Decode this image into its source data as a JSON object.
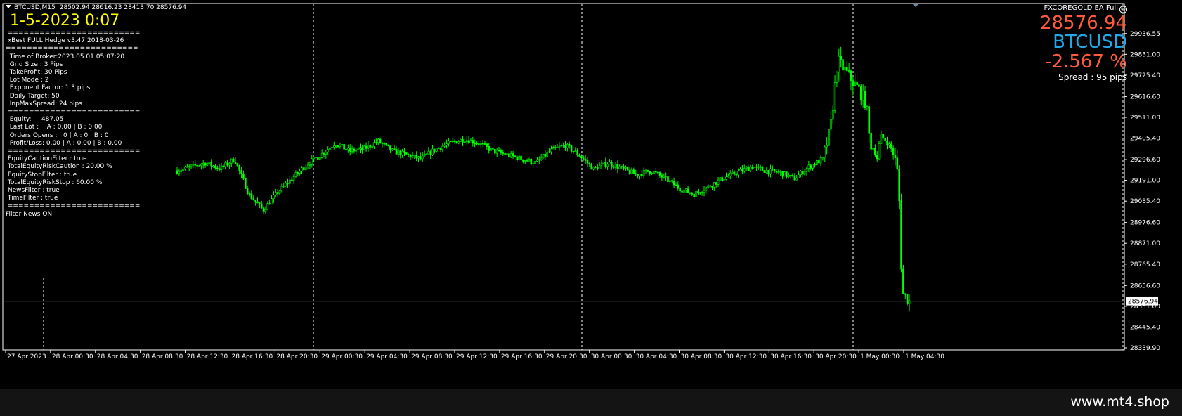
{
  "header": {
    "symbol_tf": "BTCUSD,M15",
    "ohlc": "28502.94 28616.23 28413.70 28576.94"
  },
  "datetime": "1-5-2023 0:07",
  "info_lines": [
    " =========================",
    " xBest FULL Hedge v3.47 2018-03-26",
    "=========================",
    "  Time of Broker:2023.05.01 05:07:20",
    "  Grid Size : 3 Pips",
    "  TakeProfit: 30 Pips",
    "  Lot Mode : 2",
    "  Exponent Factor: 1.3 pips",
    "  Daily Target: 50",
    "  InpMaxSpread: 24 pips",
    " =========================",
    "  Equity:     487.05",
    "  Last Lot :  | A : 0.00 | B : 0.00",
    "  Orders Opens :   0 | A : 0 | B : 0",
    "  Profit/Loss: 0.00 | A : 0.00 | B : 0.00",
    " =========================",
    " EquityCautionFilter : true",
    " TotalEquityRiskCaution : 20.00 %",
    " EquityStopFilter : true",
    " TotalEquityRiskStop : 60.00 %",
    " NewsFilter : true",
    " TimeFilter : true",
    " =========================",
    "Filter News ON"
  ],
  "right_panel": {
    "ea_name": "FXCOREGOLD EA Full",
    "ea_icon": "smiley-icon",
    "price": "28576.94",
    "symbol": "BTCUSD",
    "change": "-2.567 %",
    "spread": "Spread : 95 pips"
  },
  "footer": {
    "brand": "www.mt4.shop"
  },
  "colors": {
    "candle": "#00ff00",
    "price_big": "#ff5a3c",
    "symbol_big": "#1fa9e8",
    "datetime": "#ffff00"
  },
  "chart_data": {
    "type": "candlestick",
    "current_price": 28576.94,
    "current_price_label": "28576.94",
    "ylim": [
      28339.9,
      30000.0
    ],
    "y_ticks": [
      29936.55,
      29831.0,
      29725.4,
      29616.6,
      29511.0,
      29405.4,
      29296.6,
      29191.0,
      29085.4,
      28976.6,
      28871.0,
      28765.4,
      28656.6,
      28551.0,
      28445.4,
      28339.9
    ],
    "y_tick_labels": [
      "29936.55",
      "29831.00",
      "29725.40",
      "29616.60",
      "29511.00",
      "29405.40",
      "29296.60",
      "29191.00",
      "29085.40",
      "28976.60",
      "28871.00",
      "28765.40",
      "28656.60",
      "28551.00",
      "28445.40",
      "28339.90"
    ],
    "x_ticks": [
      "27 Apr 2023",
      "28 Apr 00:30",
      "28 Apr 04:30",
      "28 Apr 08:30",
      "28 Apr 12:30",
      "28 Apr 16:30",
      "28 Apr 20:30",
      "29 Apr 00:30",
      "29 Apr 04:30",
      "29 Apr 08:30",
      "29 Apr 12:30",
      "29 Apr 16:30",
      "29 Apr 20:30",
      "30 Apr 00:30",
      "30 Apr 04:30",
      "30 Apr 08:30",
      "30 Apr 12:30",
      "30 Apr 16:30",
      "30 Apr 20:30",
      "1 May 00:30",
      "1 May 04:30"
    ],
    "day_separators": [
      "28 Apr",
      "29 Apr",
      "30 Apr",
      "1 May"
    ],
    "price_path": [
      [
        0.0,
        29240
      ],
      [
        0.02,
        29260
      ],
      [
        0.04,
        29280
      ],
      [
        0.06,
        29250
      ],
      [
        0.08,
        29300
      ],
      [
        0.1,
        29120
      ],
      [
        0.12,
        29040
      ],
      [
        0.14,
        29130
      ],
      [
        0.16,
        29200
      ],
      [
        0.18,
        29270
      ],
      [
        0.2,
        29320
      ],
      [
        0.22,
        29380
      ],
      [
        0.24,
        29340
      ],
      [
        0.26,
        29350
      ],
      [
        0.28,
        29390
      ],
      [
        0.3,
        29340
      ],
      [
        0.32,
        29320
      ],
      [
        0.34,
        29300
      ],
      [
        0.36,
        29350
      ],
      [
        0.38,
        29380
      ],
      [
        0.4,
        29400
      ],
      [
        0.42,
        29380
      ],
      [
        0.44,
        29340
      ],
      [
        0.46,
        29320
      ],
      [
        0.48,
        29300
      ],
      [
        0.5,
        29280
      ],
      [
        0.52,
        29340
      ],
      [
        0.54,
        29370
      ],
      [
        0.56,
        29320
      ],
      [
        0.58,
        29250
      ],
      [
        0.6,
        29280
      ],
      [
        0.62,
        29250
      ],
      [
        0.64,
        29220
      ],
      [
        0.66,
        29240
      ],
      [
        0.68,
        29200
      ],
      [
        0.7,
        29150
      ],
      [
        0.72,
        29120
      ],
      [
        0.74,
        29160
      ],
      [
        0.76,
        29200
      ],
      [
        0.78,
        29230
      ],
      [
        0.8,
        29260
      ],
      [
        0.82,
        29240
      ],
      [
        0.84,
        29230
      ],
      [
        0.86,
        29200
      ],
      [
        0.88,
        29260
      ],
      [
        0.9,
        29300
      ],
      [
        0.91,
        29450
      ],
      [
        0.92,
        29800
      ],
      [
        0.93,
        29750
      ],
      [
        0.94,
        29700
      ],
      [
        0.95,
        29650
      ],
      [
        0.96,
        29580
      ],
      [
        0.965,
        29380
      ],
      [
        0.97,
        29360
      ],
      [
        0.975,
        29300
      ],
      [
        0.98,
        29420
      ],
      [
        0.985,
        29400
      ],
      [
        0.99,
        29380
      ],
      [
        0.995,
        29350
      ],
      [
        1.0,
        29300
      ],
      [
        1.005,
        29200
      ],
      [
        1.01,
        28620
      ],
      [
        1.02,
        28576
      ]
    ]
  }
}
